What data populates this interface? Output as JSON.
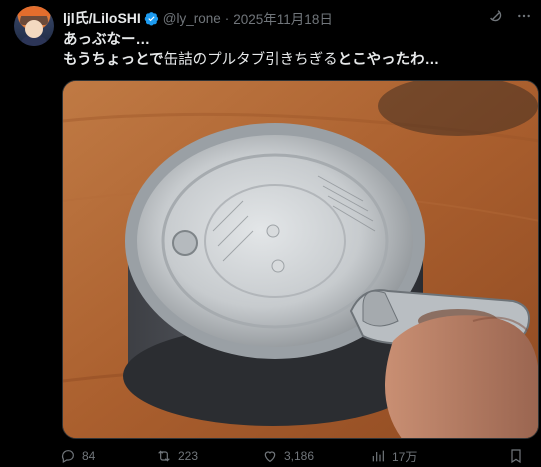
{
  "post": {
    "display_name": "ljl氏/LiloSHI",
    "handle": "@ly_rone",
    "separator": "·",
    "date": "2025年11月18日",
    "text_line1": "あっぶなー…",
    "text_line2_a": "もうちょっとで",
    "text_line2_b": "缶詰のプルタブ引きちぎる",
    "text_line2_c": "とこやったわ…",
    "verified_color": "#1d9bf0",
    "image_description_icons": [
      "avatar",
      "can-photo"
    ]
  },
  "actions": {
    "replies": "84",
    "reposts": "223",
    "likes": "3,186",
    "views": "17万"
  },
  "icons": {
    "grok": "grok-icon",
    "more": "more-icon",
    "reply": "reply-icon",
    "repost": "repost-icon",
    "like": "like-icon",
    "views": "views-icon",
    "bookmark": "bookmark-icon"
  }
}
